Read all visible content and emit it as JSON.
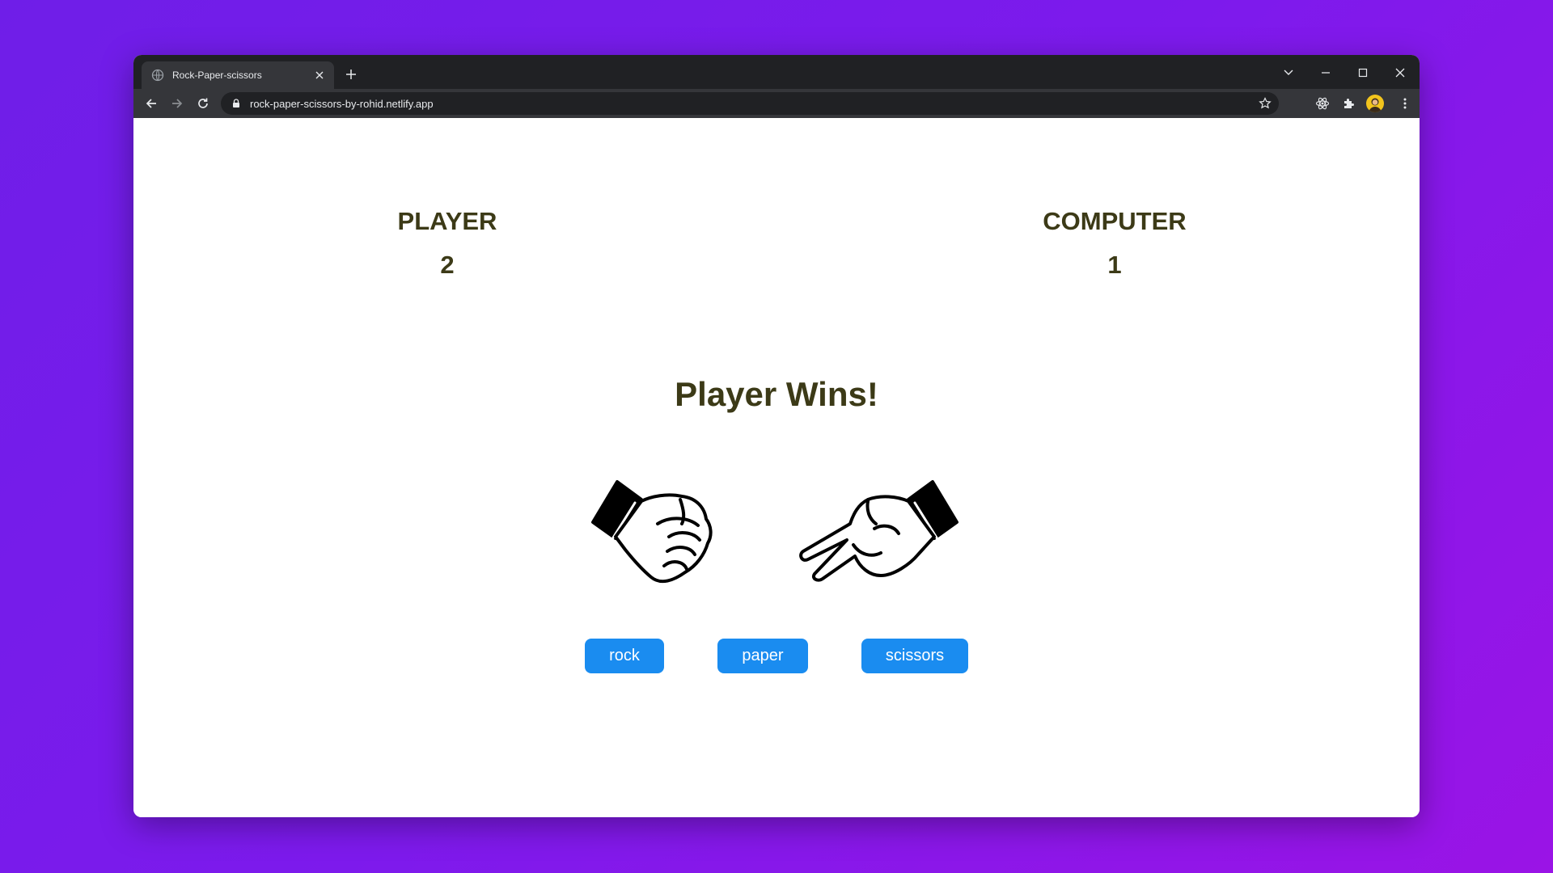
{
  "browser": {
    "tab_title": "Rock-Paper-scissors",
    "url": "rock-paper-scissors-by-rohid.netlify.app",
    "icons": [
      "globe-icon",
      "close-icon",
      "plus-icon",
      "chevron-down-icon",
      "minimize-icon",
      "maximize-icon",
      "close-window-icon",
      "back-icon",
      "forward-icon",
      "reload-icon",
      "lock-icon",
      "star-icon",
      "atom-icon",
      "puzzle-icon",
      "avatar",
      "kebab-menu-icon"
    ]
  },
  "game": {
    "player_label": "PLAYER",
    "player_score": "2",
    "computer_label": "COMPUTER",
    "computer_score": "1",
    "result": "Player Wins!",
    "player_hand": "rock",
    "computer_hand": "scissors",
    "buttons": {
      "rock": "rock",
      "paper": "paper",
      "scissors": "scissors"
    }
  },
  "colors": {
    "background_gradient_start": "#6f1ee8",
    "background_gradient_end": "#9a14e6",
    "text": "#3c3a17",
    "button": "#1a8cf0",
    "button_text": "#ffffff"
  }
}
